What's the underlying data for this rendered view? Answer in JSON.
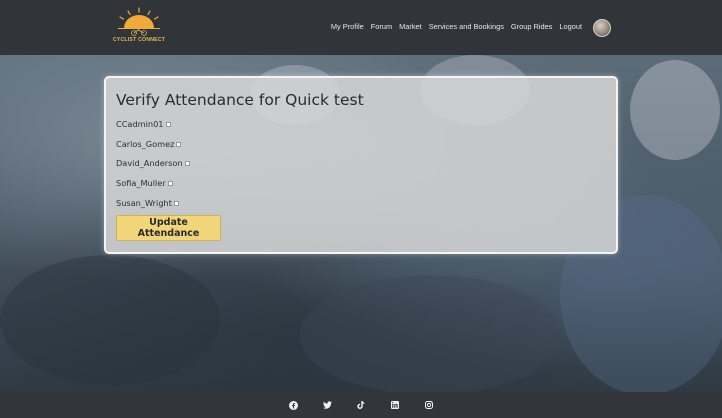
{
  "header": {
    "logo_text": "CYCLIST CONNECT",
    "nav": [
      "My Profile",
      "Forum",
      "Market",
      "Services and Bookings",
      "Group Rides",
      "Logout"
    ]
  },
  "card": {
    "title": "Verify Attendance for Quick test",
    "attendees": [
      {
        "name": "CCadmin01",
        "checked": false
      },
      {
        "name": "Carlos_Gomez",
        "checked": false
      },
      {
        "name": "David_Anderson",
        "checked": false
      },
      {
        "name": "Sofia_Muller",
        "checked": false
      },
      {
        "name": "Susan_Wright",
        "checked": false
      }
    ],
    "button_label": "Update Attendance"
  },
  "footer": {
    "icons": [
      "facebook-icon",
      "twitter-icon",
      "tiktok-icon",
      "linkedin-icon",
      "instagram-icon"
    ]
  },
  "colors": {
    "nav_bg": "#31353a",
    "accent": "#f0d57a",
    "card_bg": "#d6d6d6"
  }
}
